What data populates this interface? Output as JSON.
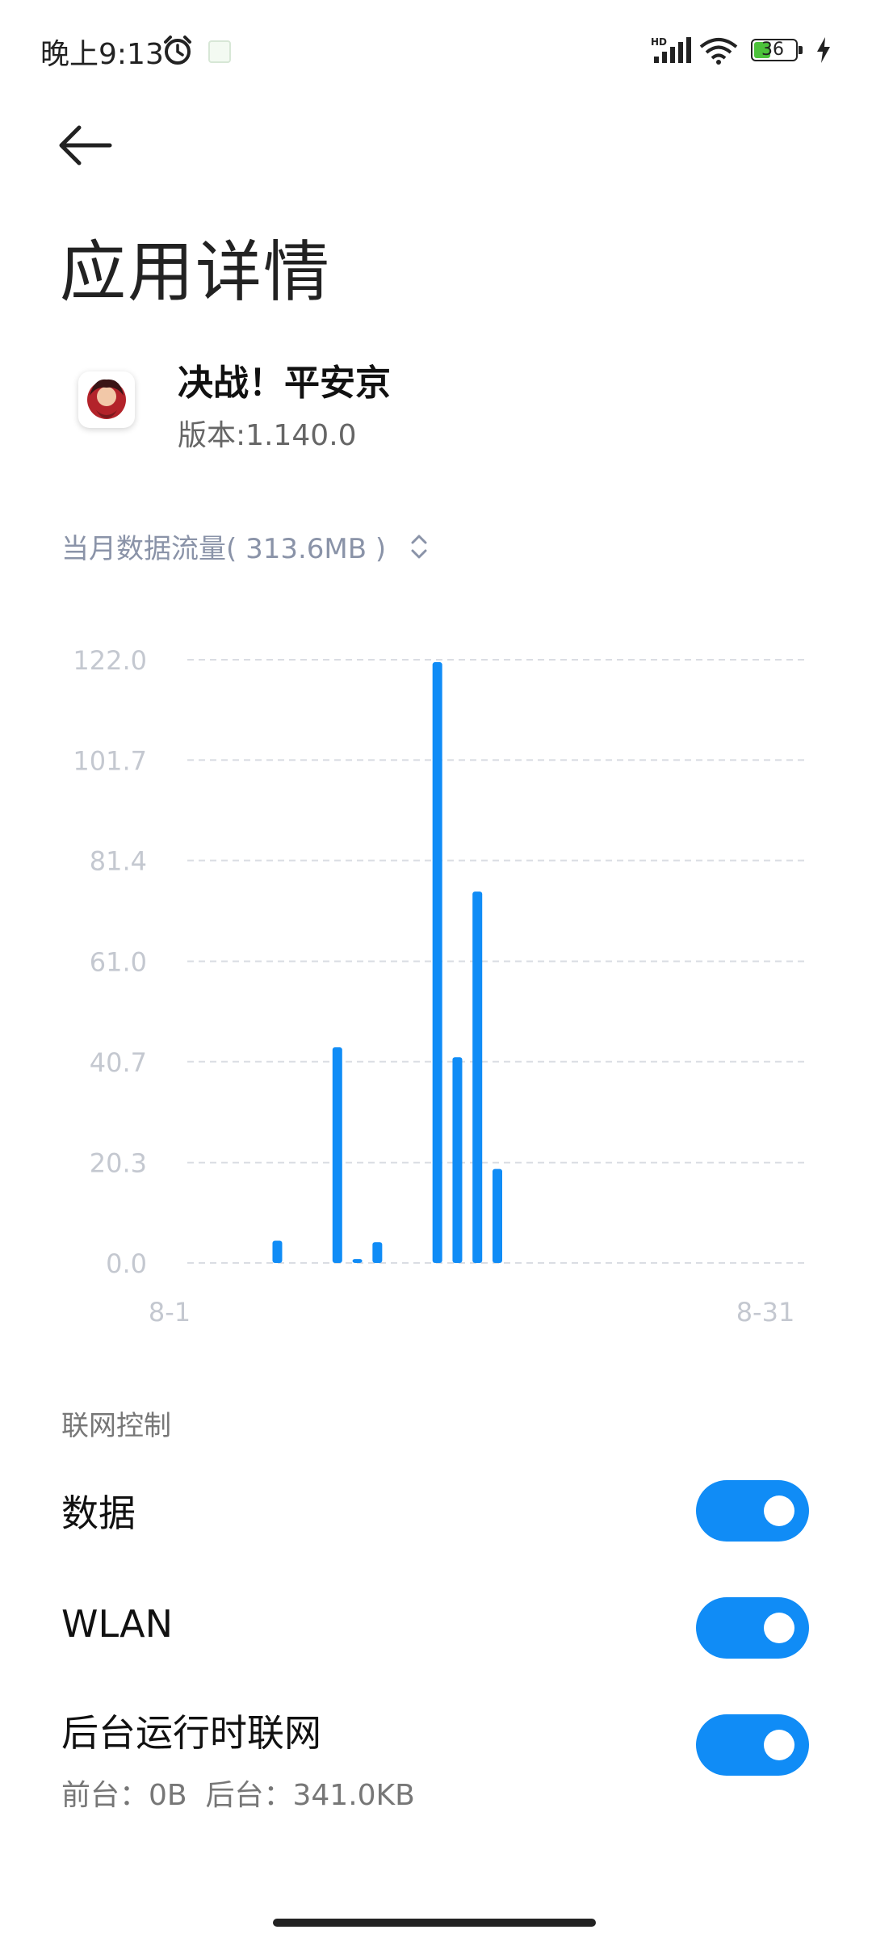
{
  "status_bar": {
    "time": "晚上9:13",
    "battery": "36",
    "icons": [
      "alarm-icon",
      "notification-icon",
      "hd-signal-icon",
      "wifi-icon",
      "battery-icon",
      "charging-icon"
    ]
  },
  "header": {
    "back_icon": "back-arrow-icon",
    "title": "应用详情"
  },
  "app": {
    "name": "决战！平安京",
    "version": "版本:1.140.0"
  },
  "usage": {
    "label": "当月数据流量( 313.6MB )",
    "selector_icon": "unfold-icon"
  },
  "chart_data": {
    "type": "bar",
    "xlabels": [
      "8-1",
      "8-31"
    ],
    "x": [
      1,
      2,
      3,
      4,
      5,
      6,
      7,
      8,
      9,
      10,
      11,
      12,
      13,
      14,
      15,
      16,
      17,
      18,
      19,
      20,
      21,
      22,
      23,
      24,
      25,
      26,
      27,
      28,
      29,
      30,
      31
    ],
    "values": [
      0,
      0,
      0,
      0,
      4.5,
      0,
      0,
      43.6,
      0.8,
      4.2,
      0,
      0,
      121.5,
      41.6,
      75.1,
      19.0,
      0,
      0,
      0,
      0,
      0,
      0,
      0,
      0,
      0,
      0,
      0,
      0,
      0,
      0,
      0
    ],
    "yticks": [
      "0.0",
      "20.3",
      "40.7",
      "61.0",
      "81.4",
      "101.7",
      "122.0"
    ],
    "ylim": [
      0,
      122.0
    ],
    "grid": true,
    "bar_color": "#108cf6"
  },
  "network": {
    "section_label": "联网控制",
    "rows": [
      {
        "label": "数据",
        "enabled": true
      },
      {
        "label": "WLAN",
        "enabled": true
      },
      {
        "label": "后台运行时联网",
        "sublabel": "前台：0B  后台：341.0KB",
        "enabled": true
      }
    ]
  },
  "colors": {
    "accent": "#108cf6",
    "muted_text": "#8a93a8"
  }
}
